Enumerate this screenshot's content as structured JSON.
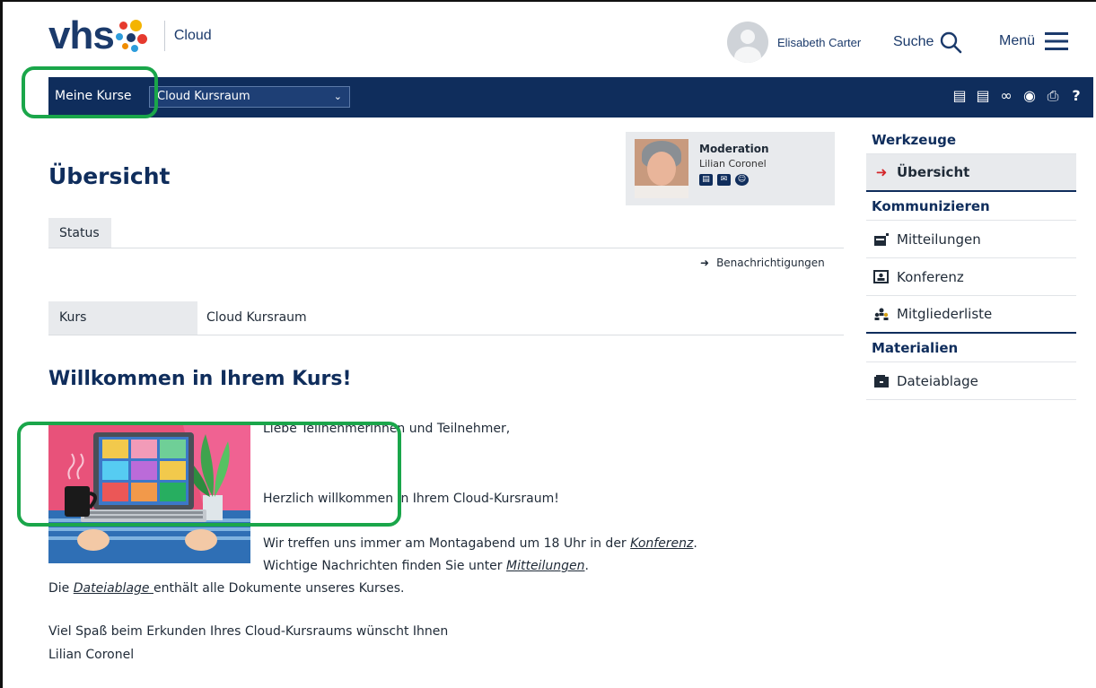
{
  "brand": {
    "logo_text": "vhs",
    "product": "Cloud",
    "accent": "#0f2d5c"
  },
  "header": {
    "user_name": "Elisabeth Carter",
    "search_label": "Suche",
    "menu_label": "Menü"
  },
  "navbar": {
    "my_courses": "Meine Kurse",
    "course_select": "Cloud Kursraum",
    "tools": [
      "presentation-icon",
      "notes-icon",
      "link-icon",
      "help-bubble-icon",
      "print-icon",
      "question-icon"
    ]
  },
  "moderation": {
    "title": "Moderation",
    "name": "Lilian Coronel",
    "icons": [
      "vcard-icon",
      "mail-icon",
      "smiley-icon"
    ]
  },
  "main": {
    "title": "Übersicht",
    "status_tab": "Status",
    "notifications_link": "Benachrichtigungen",
    "course_label": "Kurs",
    "course_value": "Cloud Kursraum",
    "welcome_heading": "Willkommen in Ihrem Kurs!",
    "greeting": "Liebe Teilnehmerinnen und Teilnehmer,",
    "welcome_line": "Herzlich willkommen in Ihrem Cloud-Kursraum!",
    "meeting_prefix": "Wir treffen uns immer am Montagabend um 18 Uhr in der ",
    "meeting_link": "Konferenz",
    "meeting_suffix": ".",
    "news_prefix": "Wichtige Nachrichten finden Sie unter ",
    "news_link": "Mitteilungen",
    "news_suffix": ".",
    "files_prefix": "Die ",
    "files_link": "Dateiablage ",
    "files_suffix": "enthält alle Dokumente unseres Kurses.",
    "closing": "Viel Spaß beim Erkunden Ihres Cloud-Kursraums wünscht Ihnen",
    "signature": "Lilian Coronel"
  },
  "sidebar": {
    "tools_heading": "Werkzeuge",
    "overview": "Übersicht",
    "communicate_heading": "Kommunizieren",
    "messages": "Mitteilungen",
    "conference": "Konferenz",
    "members": "Mitgliederliste",
    "materials_heading": "Materialien",
    "files": "Dateiablage"
  },
  "colors": {
    "highlight": "#1aa64a",
    "active_arrow": "#d4262a"
  }
}
